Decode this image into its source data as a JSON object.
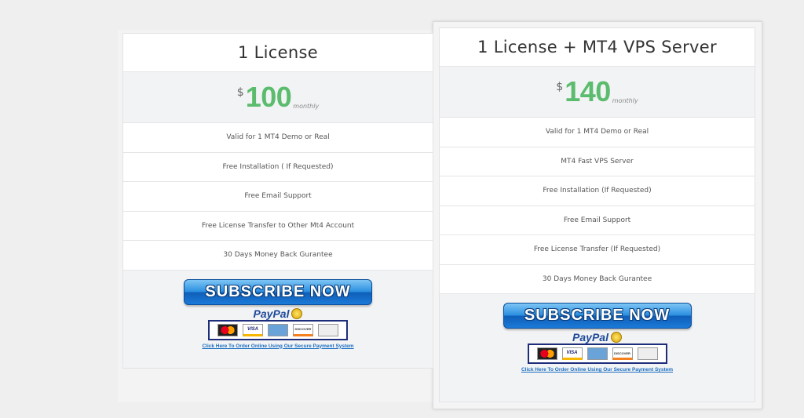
{
  "plans": [
    {
      "title": "1 License",
      "currency": "$",
      "amount": "100",
      "period": "monthly",
      "features": [
        "Valid for 1 MT4 Demo or Real",
        "Free Installation ( If Requested)",
        "Free Email Support",
        "Free License Transfer to Other Mt4 Account",
        "30 Days Money Back Gurantee"
      ],
      "subscribe_label": "SUBSCRIBE NOW",
      "paypal_label": "PayPal",
      "cards": [
        "MasterCard",
        "VISA",
        "AMERICAN EXPRESS",
        "DISCOVER",
        "ELECTRONIC CHECK"
      ],
      "order_link": "Click Here To Order Online Using Our Secure Payment System"
    },
    {
      "title": "1 License + MT4 VPS Server",
      "currency": "$",
      "amount": "140",
      "period": "monthly",
      "features": [
        "Valid for 1 MT4 Demo or Real",
        "MT4 Fast VPS Server",
        "Free Installation (If Requested)",
        "Free Email Support",
        "Free License Transfer (If Requested)",
        "30 Days Money Back Gurantee"
      ],
      "subscribe_label": "SUBSCRIBE NOW",
      "paypal_label": "PayPal",
      "cards": [
        "MasterCard",
        "VISA",
        "AMERICAN EXPRESS",
        "DISCOVER",
        "ELECTRONIC CHECK"
      ],
      "order_link": "Click Here To Order Online Using Our Secure Payment System"
    }
  ],
  "colors": {
    "price_green": "#5bbc6e",
    "background": "#efefef",
    "button_blue": "#2b8fe0"
  }
}
